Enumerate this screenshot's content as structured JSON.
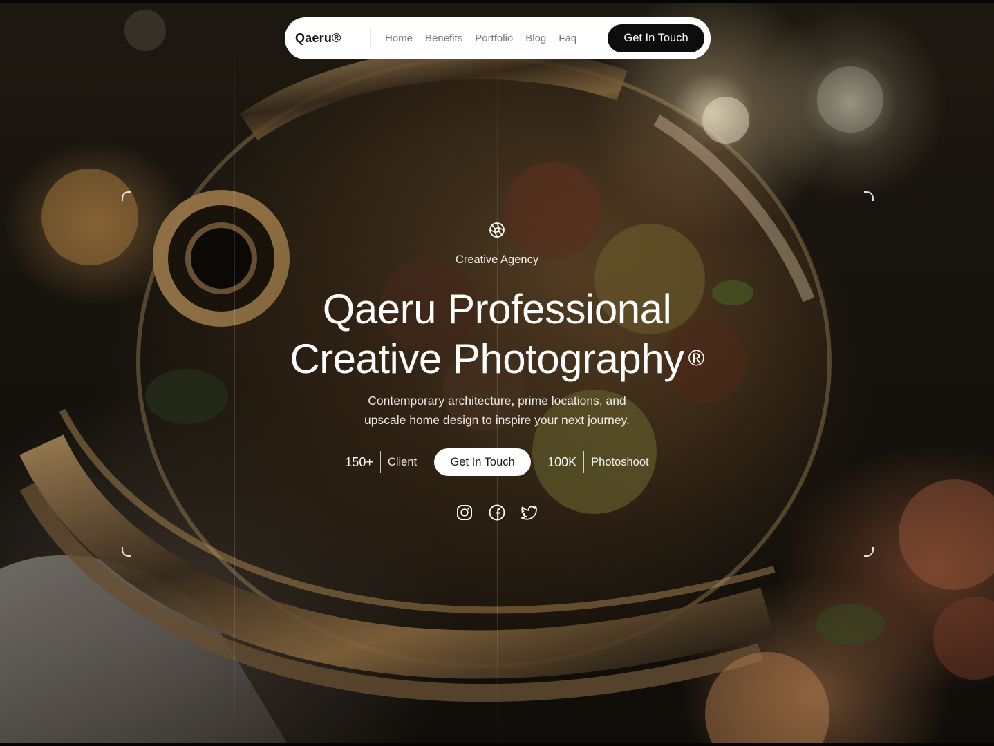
{
  "nav": {
    "brand": "Qaeru®",
    "links": [
      "Home",
      "Benefits",
      "Portfolio",
      "Blog",
      "Faq"
    ],
    "cta": "Get In Touch"
  },
  "hero": {
    "eyebrow": "Creative Agency",
    "headline_line1": "Qaeru Professional",
    "headline_line2": "Creative Photography",
    "headline_mark": "®",
    "subtitle_line1": "Contemporary architecture, prime locations, and",
    "subtitle_line2": "upscale home design to inspire your next journey.",
    "stats": [
      {
        "value": "150+",
        "label": "Client"
      },
      {
        "value": "100K",
        "label": "Photoshoot"
      }
    ],
    "cta": "Get In Touch",
    "social_icons": [
      "instagram-icon",
      "facebook-icon",
      "twitter-icon"
    ]
  },
  "colors": {
    "nav_bg": "#ffffff",
    "nav_cta_bg": "#0d0d0d",
    "hero_cta_bg": "#ffffff",
    "text_light": "#ffffff"
  }
}
